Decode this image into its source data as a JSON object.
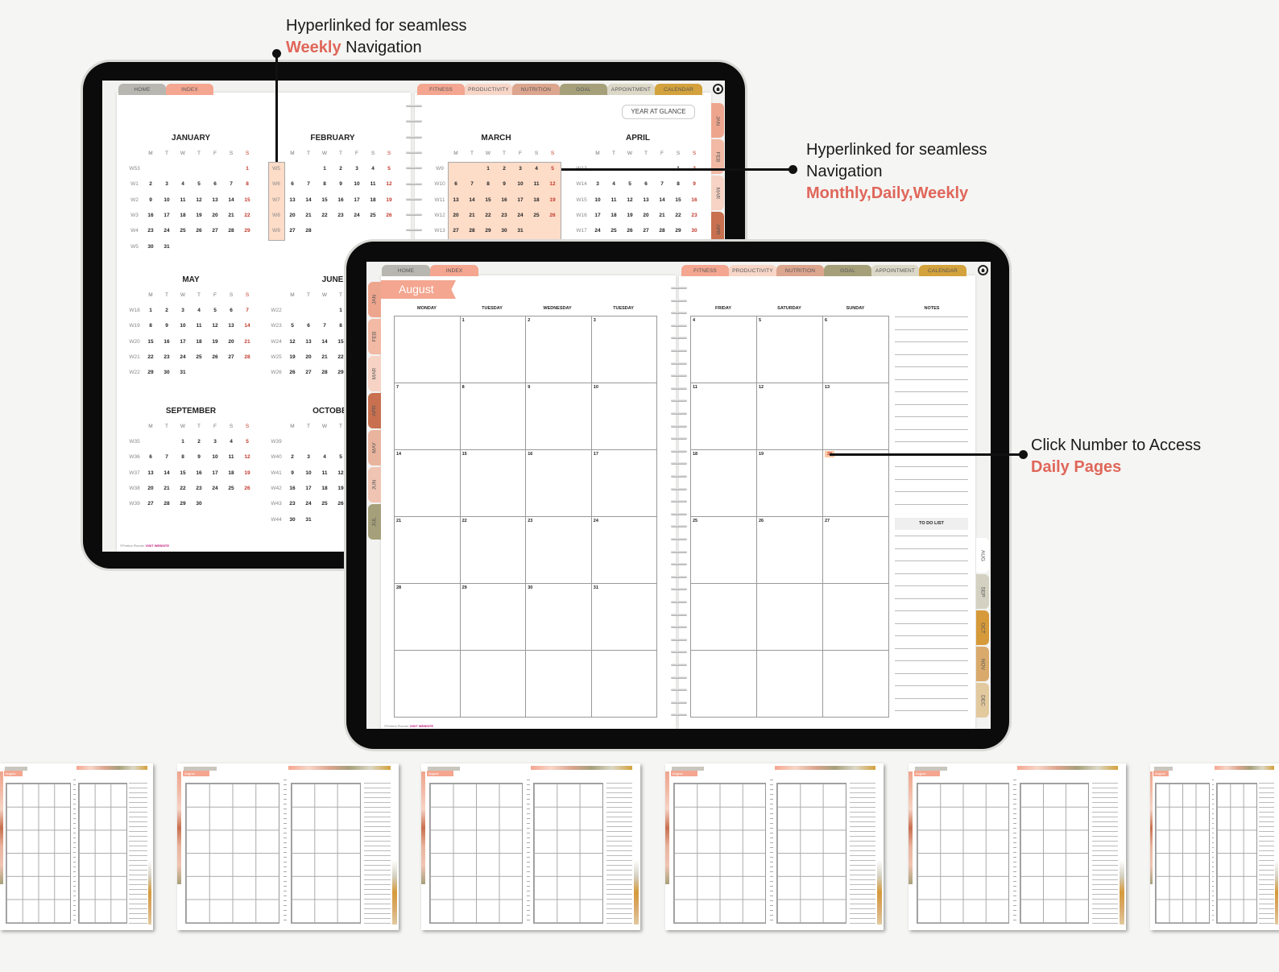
{
  "annotations": {
    "weekly": {
      "line1": "Hyperlinked for seamless",
      "highlight": "Weekly",
      "rest": " Navigation"
    },
    "monthly": {
      "line1": "Hyperlinked for seamless",
      "line2": "Navigation",
      "highlight": "Monthly,Daily,Weekly"
    },
    "daily": {
      "line1": "Click Number to Access",
      "highlight": "Daily Pages"
    }
  },
  "colors": {
    "accent": "#e0665a",
    "sunday": "#c0392b",
    "highlight": "#fddcc8"
  },
  "top_tabs_left": [
    {
      "label": "HOME",
      "color": "#b8b6b0"
    },
    {
      "label": "INDEX",
      "color": "#f4a690"
    }
  ],
  "top_tabs_right": [
    {
      "label": "FITNESS",
      "color": "#f4a690"
    },
    {
      "label": "PRODUCTIVITY",
      "color": "#f7d6c8"
    },
    {
      "label": "NUTRITION",
      "color": "#dca58e"
    },
    {
      "label": "GOAL",
      "color": "#a6a07a"
    },
    {
      "label": "APPOINTMENT",
      "color": "#dcd8c8"
    },
    {
      "label": "CALENDAR",
      "color": "#d3a23c"
    }
  ],
  "home_icon": "home-icon",
  "back": {
    "year_button": "YEAR AT GLANCE",
    "side_tabs": [
      {
        "label": "JAN",
        "color": "#eea58e"
      },
      {
        "label": "FEB",
        "color": "#f2b9a4"
      },
      {
        "label": "MAR",
        "color": "#f6d3c4"
      },
      {
        "label": "APR",
        "color": "#c8704f"
      }
    ],
    "footer": {
      "copy": "©Pretina Planner",
      "link": "VISIT WEBSITE"
    },
    "day_letters": [
      "M",
      "T",
      "W",
      "T",
      "F",
      "S",
      "S"
    ],
    "months": [
      {
        "name": "JANUARY",
        "weeks": [
          [
            "W53",
            [
              null,
              null,
              null,
              null,
              null,
              null,
              1
            ]
          ],
          [
            "W1",
            [
              2,
              3,
              4,
              5,
              6,
              7,
              8
            ]
          ],
          [
            "W2",
            [
              9,
              10,
              11,
              12,
              13,
              14,
              15
            ]
          ],
          [
            "W3",
            [
              16,
              17,
              18,
              19,
              20,
              21,
              22
            ]
          ],
          [
            "W4",
            [
              23,
              24,
              25,
              26,
              27,
              28,
              29
            ]
          ],
          [
            "W5",
            [
              30,
              31
            ]
          ]
        ]
      },
      {
        "name": "FEBRUARY",
        "weeks": [
          [
            "W5",
            [
              null,
              null,
              1,
              2,
              3,
              4,
              5
            ]
          ],
          [
            "W6",
            [
              6,
              7,
              8,
              9,
              10,
              11,
              12
            ]
          ],
          [
            "W7",
            [
              13,
              14,
              15,
              16,
              17,
              18,
              19
            ]
          ],
          [
            "W8",
            [
              20,
              21,
              22,
              23,
              24,
              25,
              26
            ]
          ],
          [
            "W9",
            [
              27,
              28
            ]
          ]
        ]
      },
      {
        "name": "MARCH",
        "weeks": [
          [
            "W9",
            [
              null,
              null,
              1,
              2,
              3,
              4,
              5
            ]
          ],
          [
            "W10",
            [
              6,
              7,
              8,
              9,
              10,
              11,
              12
            ]
          ],
          [
            "W11",
            [
              13,
              14,
              15,
              16,
              17,
              18,
              19
            ]
          ],
          [
            "W12",
            [
              20,
              21,
              22,
              23,
              24,
              25,
              26
            ]
          ],
          [
            "W13",
            [
              27,
              28,
              29,
              30,
              31
            ]
          ]
        ]
      },
      {
        "name": "APRIL",
        "weeks": [
          [
            "W13",
            [
              null,
              null,
              null,
              null,
              null,
              1,
              2
            ]
          ],
          [
            "W14",
            [
              3,
              4,
              5,
              6,
              7,
              8,
              9
            ]
          ],
          [
            "W15",
            [
              10,
              11,
              12,
              13,
              14,
              15,
              16
            ]
          ],
          [
            "W16",
            [
              17,
              18,
              19,
              20,
              21,
              22,
              23
            ]
          ],
          [
            "W17",
            [
              24,
              25,
              26,
              27,
              28,
              29,
              30
            ]
          ]
        ]
      },
      {
        "name": "MAY",
        "weeks": [
          [
            "W18",
            [
              1,
              2,
              3,
              4,
              5,
              6,
              7
            ]
          ],
          [
            "W19",
            [
              8,
              9,
              10,
              11,
              12,
              13,
              14
            ]
          ],
          [
            "W20",
            [
              15,
              16,
              17,
              18,
              19,
              20,
              21
            ]
          ],
          [
            "W21",
            [
              22,
              23,
              24,
              25,
              26,
              27,
              28
            ]
          ],
          [
            "W22",
            [
              29,
              30,
              31
            ]
          ]
        ]
      },
      {
        "name": "JUNE",
        "cols": 4,
        "weeks": [
          [
            "W22",
            [
              null,
              null,
              null,
              1
            ]
          ],
          [
            "W23",
            [
              5,
              6,
              7,
              8
            ]
          ],
          [
            "W24",
            [
              12,
              13,
              14,
              15
            ]
          ],
          [
            "W25",
            [
              19,
              20,
              21,
              22
            ]
          ],
          [
            "W26",
            [
              26,
              27,
              28,
              29
            ]
          ]
        ]
      },
      {
        "name": "SEPTEMBER",
        "weeks": [
          [
            "W35",
            [
              null,
              null,
              1,
              2,
              3,
              4,
              5
            ]
          ],
          [
            "W36",
            [
              6,
              7,
              8,
              9,
              10,
              11,
              12
            ]
          ],
          [
            "W37",
            [
              13,
              14,
              15,
              16,
              17,
              18,
              19
            ]
          ],
          [
            "W38",
            [
              20,
              21,
              22,
              23,
              24,
              25,
              26
            ]
          ],
          [
            "W39",
            [
              27,
              28,
              29,
              30
            ]
          ]
        ]
      },
      {
        "name": "OCTOBER",
        "cols": 4,
        "weeks": [
          [
            "W39",
            []
          ],
          [
            "W40",
            [
              2,
              3,
              4,
              5
            ]
          ],
          [
            "W41",
            [
              9,
              10,
              11,
              12
            ]
          ],
          [
            "W42",
            [
              16,
              17,
              18,
              19
            ]
          ],
          [
            "W43",
            [
              23,
              24,
              25,
              26
            ]
          ],
          [
            "W44",
            [
              30,
              31
            ]
          ]
        ]
      }
    ]
  },
  "front": {
    "month_title": "August",
    "left_tabs": [
      {
        "label": "JAN",
        "color": "#eea58e"
      },
      {
        "label": "FEB",
        "color": "#f2b9a4"
      },
      {
        "label": "MAR",
        "color": "#f6d3c4"
      },
      {
        "label": "APR",
        "color": "#c8704f"
      },
      {
        "label": "MAY",
        "color": "#e9b49e"
      },
      {
        "label": "JUN",
        "color": "#f0c4b2"
      },
      {
        "label": "JUL",
        "color": "#a6a07a"
      }
    ],
    "right_tabs": [
      {
        "label": "AUG",
        "color": "#ffffff"
      },
      {
        "label": "SEP",
        "color": "#d4d1c2"
      },
      {
        "label": "OCT",
        "color": "#d69a3a"
      },
      {
        "label": "NOV",
        "color": "#d9aa6c"
      },
      {
        "label": "DEC",
        "color": "#e2c99e"
      }
    ],
    "left_days": [
      "MONDAY",
      "TUESDAY",
      "WEDNESDAY",
      "TUESDAY"
    ],
    "right_days": [
      "FRIDAY",
      "SATURDAY",
      "SUNDAY"
    ],
    "notes_label": "NOTES",
    "todo_label": "TO DO LIST",
    "left_grid": [
      [
        "",
        "1",
        "2",
        "3"
      ],
      [
        "7",
        "8",
        "9",
        "10"
      ],
      [
        "14",
        "15",
        "16",
        "17"
      ],
      [
        "21",
        "22",
        "23",
        "24"
      ],
      [
        "28",
        "29",
        "30",
        "31"
      ],
      [
        "",
        "",
        "",
        ""
      ]
    ],
    "right_grid": [
      [
        "4",
        "5",
        "6"
      ],
      [
        "11",
        "12",
        "13"
      ],
      [
        "18",
        "19",
        "20"
      ],
      [
        "25",
        "26",
        "27"
      ],
      [
        "",
        "",
        ""
      ],
      [
        "",
        "",
        ""
      ]
    ],
    "highlighted_day": "20",
    "footer": {
      "copy": "©Pretina Planner",
      "link": "VISIT WEBSITE"
    }
  },
  "thumbnails": {
    "count": 6,
    "month_title": "August"
  }
}
